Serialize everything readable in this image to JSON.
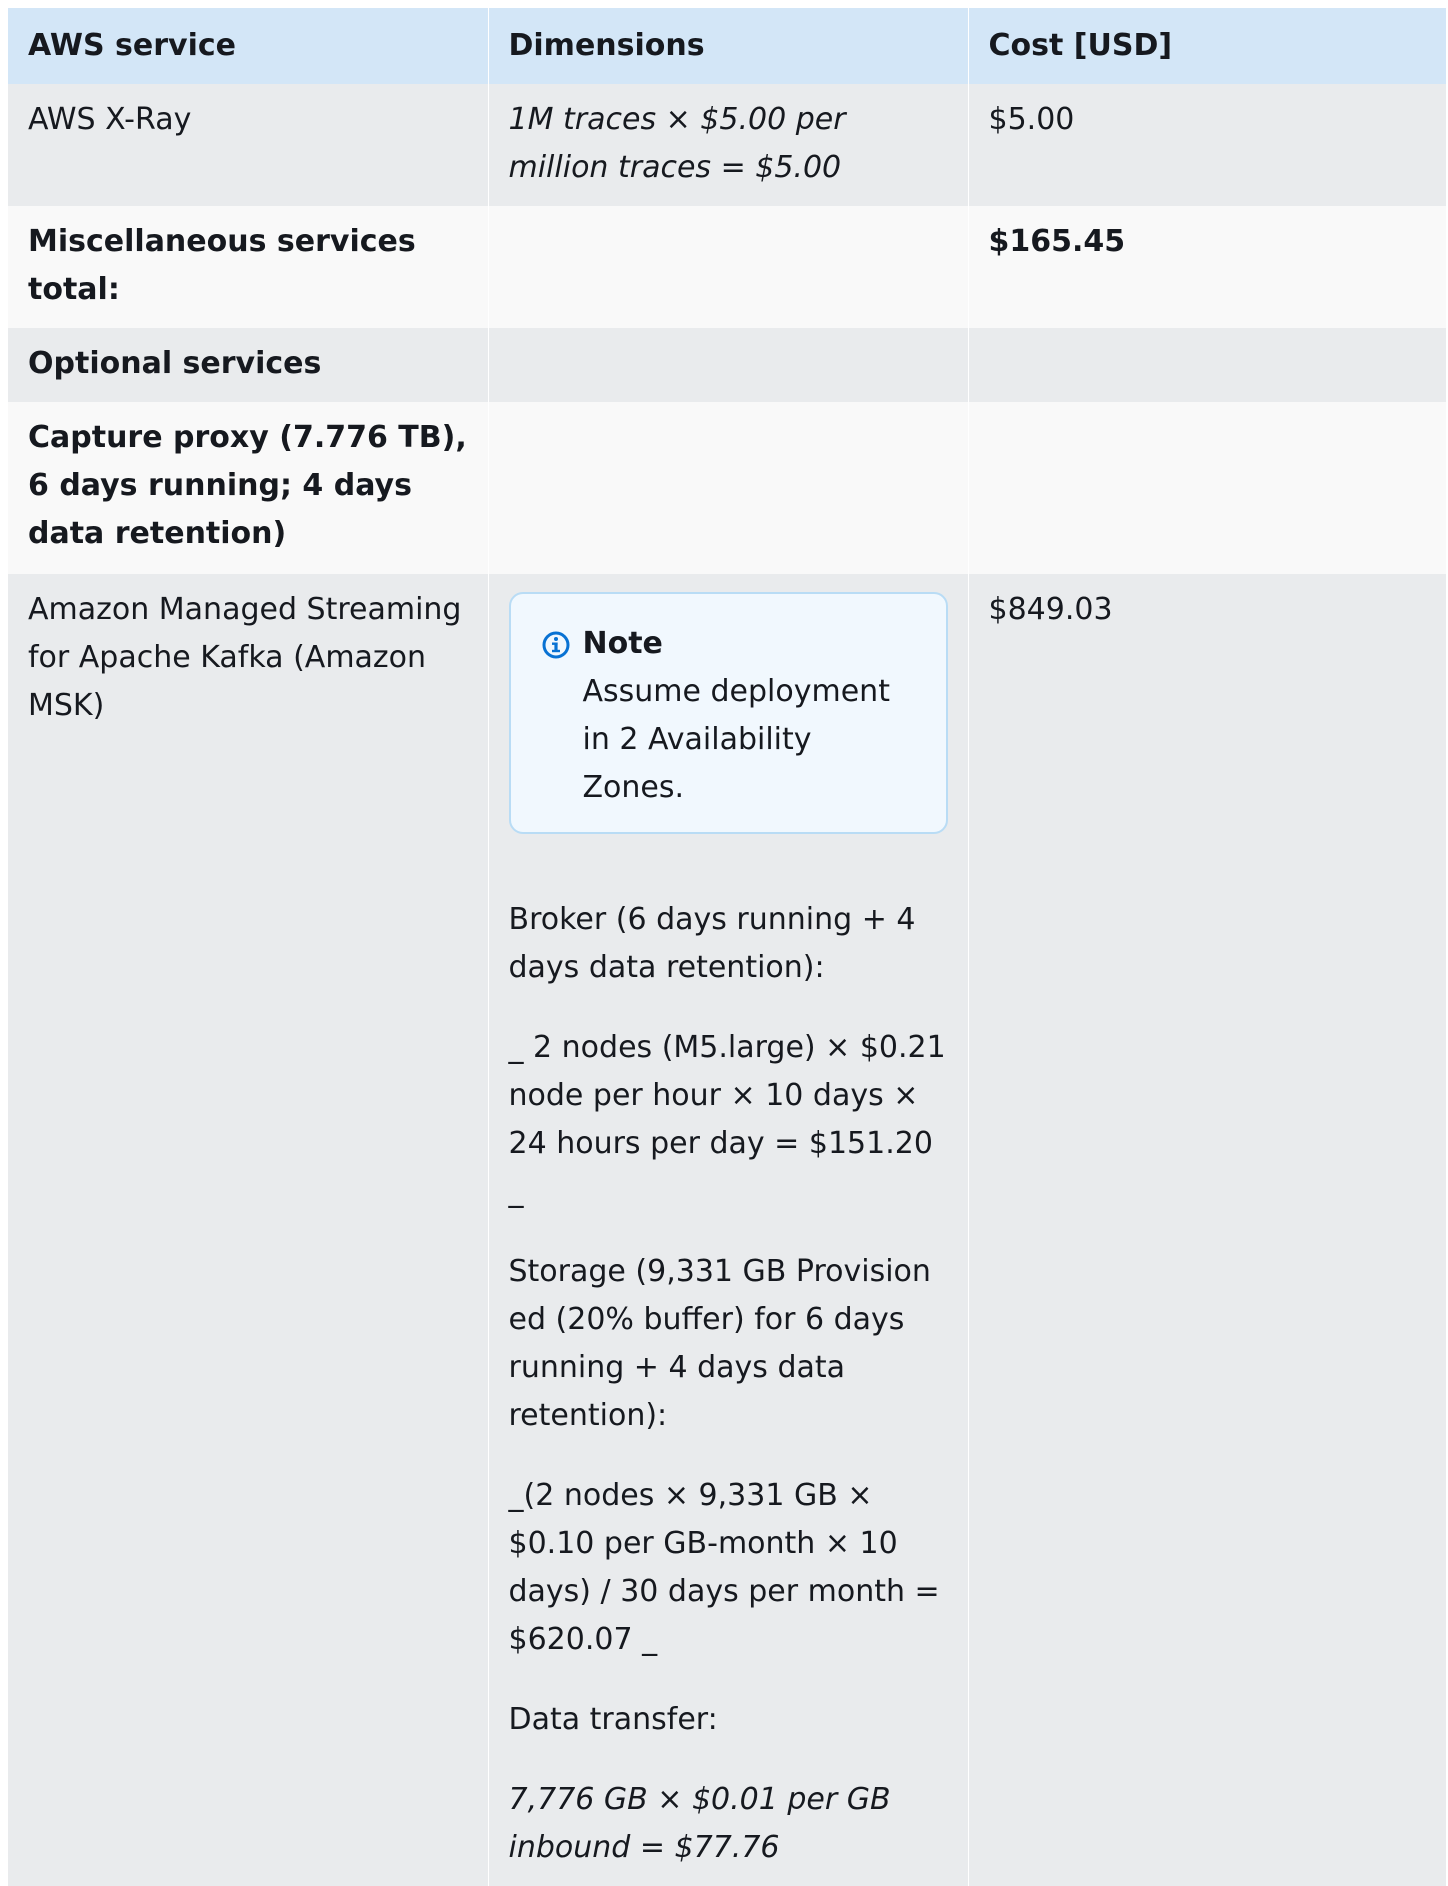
{
  "table": {
    "headers": [
      "AWS service",
      "Dimensions",
      "Cost [USD]"
    ],
    "xray": {
      "service": "AWS X-Ray",
      "dimensions": "1M traces × $5.00 per million traces = $5.00",
      "cost": "$5.00"
    },
    "misc_total": {
      "label": "Miscellaneous services total:",
      "cost": "$165.45"
    },
    "optional": {
      "label": "Optional services"
    },
    "capture_proxy": {
      "line1": "Capture proxy (7.776 TB),",
      "line2": "6 days running; 4 days data retention)"
    },
    "msk": {
      "service": "Amazon Managed Streaming for Apache Kafka (Amazon MSK)",
      "cost": "$849.03",
      "note": {
        "title": "Note",
        "text": "Assume deployment in 2 Availability Zones.",
        "icon": "info-icon"
      },
      "broker_label": "Broker (6 days running + 4 days data retention):",
      "broker_calc": "_ 2 nodes (M5.large) × $0.21 node per hour × 10 days × 24 hours per day = $151.20 _",
      "storage_label": "Storage (9,331 GB Provision ed (20% buffer) for 6 days running + 4 days data retention):",
      "storage_calc": "_(2 nodes × 9,331 GB × $0.10 per GB-month × 10 days) / 30 days per month = $620.07 _",
      "transfer_label": "Data transfer:",
      "transfer_calc": "7,776 GB × $0.01 per GB inbound = $77.76"
    }
  },
  "colors": {
    "header_bg": "#d3e6f7",
    "row_gray": "#e9ebed",
    "row_light": "#f9f9f9",
    "note_bg": "#f1f8fe",
    "note_border": "#b9dcf5",
    "info_icon": "#0972d3"
  }
}
